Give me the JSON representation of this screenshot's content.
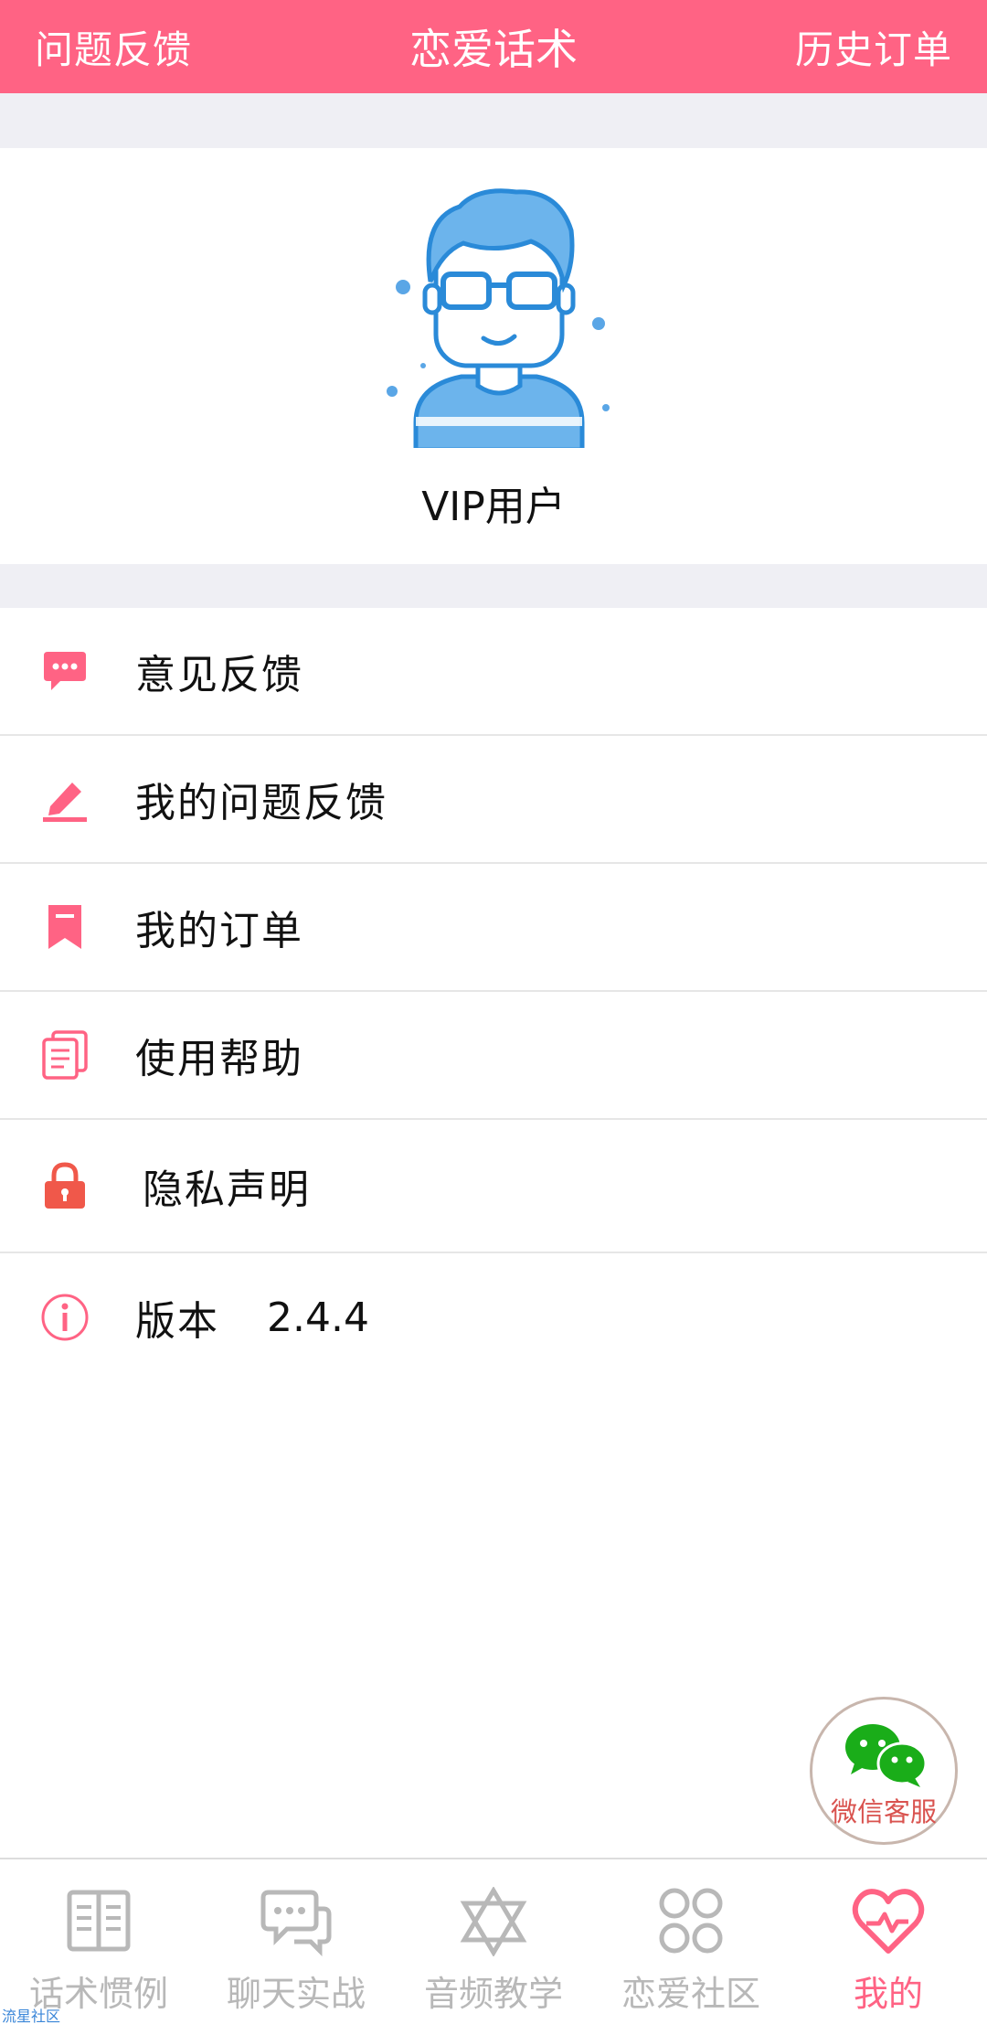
{
  "header": {
    "left": "问题反馈",
    "title": "恋爱话术",
    "right": "历史订单",
    "color": "#ff6384"
  },
  "profile": {
    "avatar_icon": "man-with-glasses-avatar",
    "username": "VIP用户"
  },
  "menu": [
    {
      "icon": "chat-bubble-icon",
      "label": "意见反馈"
    },
    {
      "icon": "pencil-icon",
      "label": "我的问题反馈"
    },
    {
      "icon": "bookmark-icon",
      "label": "我的订单"
    },
    {
      "icon": "document-stack-icon",
      "label": "使用帮助"
    },
    {
      "icon": "lock-icon",
      "label": "隐私声明"
    },
    {
      "icon": "info-icon",
      "label": "版本",
      "value": "2.4.4"
    }
  ],
  "wechat": {
    "icon": "wechat-icon",
    "label": "微信客服"
  },
  "tabs": [
    {
      "icon": "book-icon",
      "label": "话术惯例",
      "active": false
    },
    {
      "icon": "chat-icon",
      "label": "聊天实战",
      "active": false
    },
    {
      "icon": "star-of-david-icon",
      "label": "音频教学",
      "active": false
    },
    {
      "icon": "four-circles-icon",
      "label": "恋爱社区",
      "active": false
    },
    {
      "icon": "heart-pulse-icon",
      "label": "我的",
      "active": true
    }
  ],
  "watermark": "流星社区",
  "colors": {
    "accent": "#ff6384",
    "inactive": "#b8b8b8",
    "avatar_blue": "#2a8ad8"
  }
}
